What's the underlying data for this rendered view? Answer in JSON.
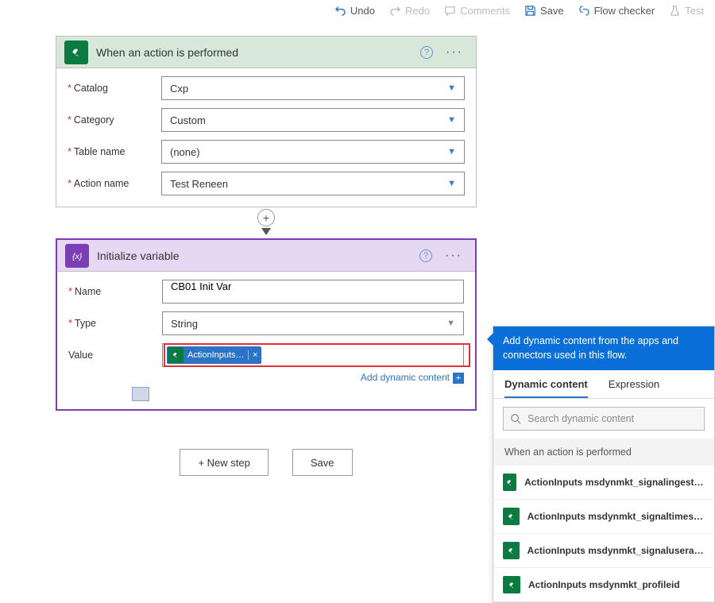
{
  "toolbar": {
    "undo": "Undo",
    "redo": "Redo",
    "comments": "Comments",
    "save": "Save",
    "flow_checker": "Flow checker",
    "test": "Test"
  },
  "trigger": {
    "title": "When an action is performed",
    "fields": {
      "catalog_label": "Catalog",
      "catalog_value": "Cxp",
      "category_label": "Category",
      "category_value": "Custom",
      "table_label": "Table name",
      "table_value": "(none)",
      "action_label": "Action name",
      "action_value": "Test Reneen"
    }
  },
  "init_var": {
    "title": "Initialize variable",
    "name_label": "Name",
    "name_value": "CB01 Init Var",
    "type_label": "Type",
    "type_value": "String",
    "value_label": "Value",
    "token_text": "ActionInputs m...",
    "add_dynamic": "Add dynamic content"
  },
  "buttons": {
    "new_step": "+ New step",
    "save": "Save"
  },
  "panel": {
    "header": "Add dynamic content from the apps and connectors used in this flow.",
    "tab_dynamic": "Dynamic content",
    "tab_expression": "Expression",
    "search_placeholder": "Search dynamic content",
    "section": "When an action is performed",
    "results": [
      "ActionInputs msdynmkt_signalingestiontimestamp",
      "ActionInputs msdynmkt_signaltimestamp",
      "ActionInputs msdynmkt_signaluserauthid",
      "ActionInputs msdynmkt_profileid"
    ]
  }
}
